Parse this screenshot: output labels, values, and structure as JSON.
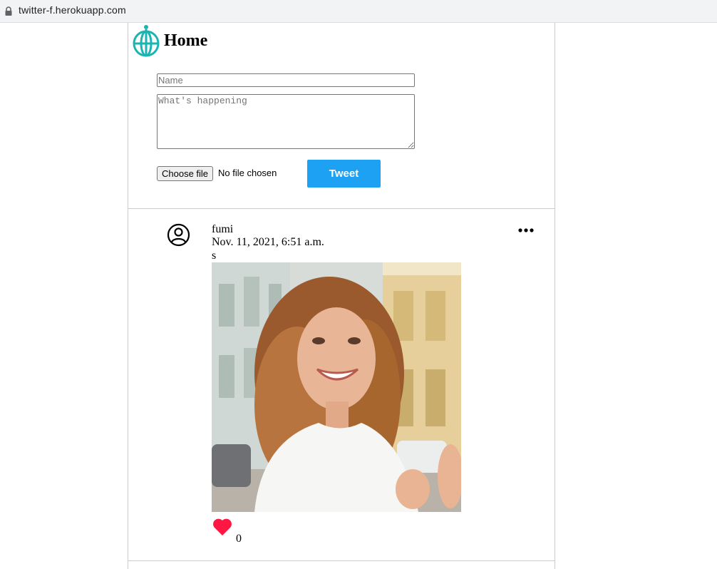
{
  "browser": {
    "url": "twitter-f.herokuapp.com"
  },
  "header": {
    "title": "Home",
    "logo_icon": "globe-pin-icon",
    "logo_color": "#1ab5b0"
  },
  "compose": {
    "name_placeholder": "Name",
    "text_placeholder": "What's happening",
    "file_button_label": "Choose file",
    "file_status": "No file chosen",
    "tweet_button_label": "Tweet",
    "tweet_button_color": "#1da1f2"
  },
  "feed": {
    "tweets": [
      {
        "username": "fumi",
        "timestamp": "Nov. 11, 2021, 6:51 a.m.",
        "text": "s",
        "avatar_icon": "user-circle-icon",
        "menu_icon": "more-dots-icon",
        "like_icon": "heart-icon",
        "like_color": "#ff1744",
        "likes": "0"
      }
    ]
  }
}
